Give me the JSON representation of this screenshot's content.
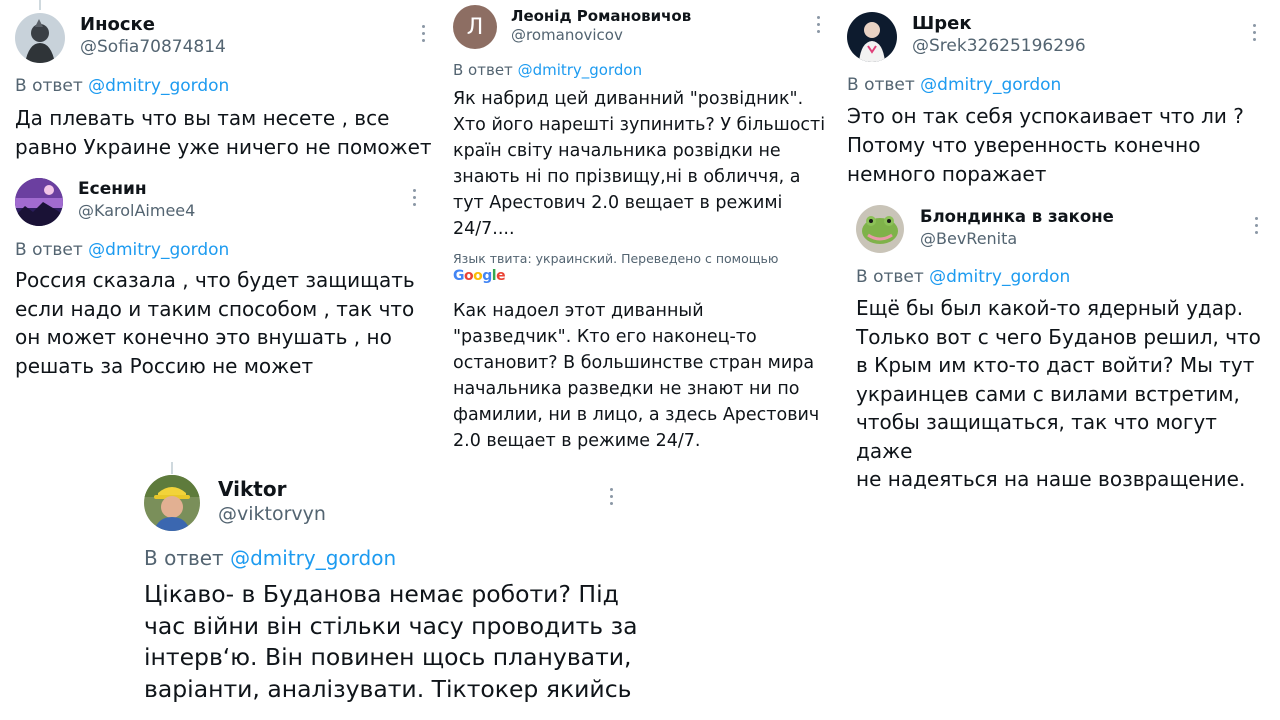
{
  "tweets": {
    "inoske": {
      "name": "Иноске",
      "handle": "@Sofia70874814",
      "reply_prefix": "В ответ",
      "reply_to": "@dmitry_gordon",
      "text": "Да плевать что вы там несете , все\nравно Украине уже ничего не поможет"
    },
    "esenin": {
      "name": "Есенин",
      "handle": "@KarolAimee4",
      "reply_prefix": "В ответ",
      "reply_to": "@dmitry_gordon",
      "text": "Россия сказала , что будет защищать\nесли надо и таким способом , так что\nон может конечно это внушать , но\nрешать за Россию не может"
    },
    "leonid": {
      "avatar_letter": "Л",
      "name": "Леонід Романовичов",
      "handle": "@romanovicov",
      "reply_prefix": "В ответ",
      "reply_to": "@dmitry_gordon",
      "text": "Як набрид цей диванний \"розвідник\".\nХто його нарешті зупинить? У більшості\nкраїн світу начальника розвідки не\nзнають ні по прізвищу,ні в обличчя, а\nтут Арестович 2.0 вещает в режимі\n24/7....",
      "translation_note": "Язык твита: украинский. Переведено с помощью",
      "translation_provider": [
        "G",
        "o",
        "o",
        "g",
        "l",
        "e"
      ],
      "translated_text": "Как надоел этот диванный\n\"разведчик\". Кто его наконец-то\nостановит? В большинстве стран мира\nначальника разведки не знают ни по\nфамилии, ни в лицо, а здесь Арестович\n2.0 вещает в режиме 24/7."
    },
    "shrek": {
      "name": "Шрек",
      "handle": "@Srek32625196296",
      "reply_prefix": "В ответ",
      "reply_to": "@dmitry_gordon",
      "text": "Это он так себя успокаивает что ли ?\nПотому что уверенность конечно\nнемного поражает"
    },
    "blondinka": {
      "name": "Блондинка в законе",
      "handle": "@BevRenita",
      "reply_prefix": "В ответ",
      "reply_to": "@dmitry_gordon",
      "text": "Ещё бы был какой-то ядерный удар.\nТолько вот с чего Буданов решил, что\nв Крым им кто-то даст войти? Мы тут\nукраинцев сами с вилами встретим,\nчтобы защищаться, так что могут даже\nне надеяться на наше возвращение."
    },
    "viktor": {
      "name": "Viktor",
      "handle": "@viktorvyn",
      "reply_prefix": "В ответ",
      "reply_to": "@dmitry_gordon",
      "text": "Цікаво- в Буданова немає роботи? Під\nчас війни він стільки часу проводить за\nінтерв‘ю. Він повинен щось планувати,\nваріанти, аналізувати. Тiктокер якийсь"
    }
  },
  "colors": {
    "link": "#1d9bf0",
    "secondary_text": "#536471",
    "primary_text": "#0f1419",
    "thread_line": "#cfd9de"
  },
  "icons": [
    "more-icon"
  ]
}
